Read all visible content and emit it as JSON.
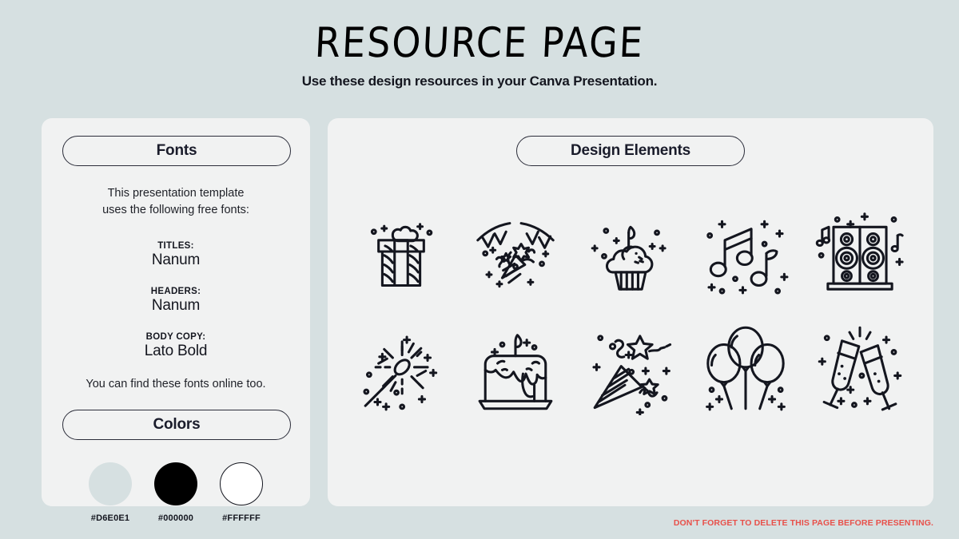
{
  "header": {
    "title": "RESOURCE PAGE",
    "subtitle": "Use these design resources in your Canva Presentation."
  },
  "fonts_panel": {
    "heading": "Fonts",
    "intro": "This presentation template\nuses the following free fonts:",
    "entries": [
      {
        "label": "TITLES:",
        "value": "Nanum"
      },
      {
        "label": "HEADERS:",
        "value": "Nanum"
      },
      {
        "label": "BODY COPY:",
        "value": "Lato Bold"
      }
    ],
    "footer": "You can find these fonts online too."
  },
  "colors_panel": {
    "heading": "Colors",
    "swatches": [
      {
        "hex": "#D6E0E1",
        "label": "#D6E0E1",
        "outlined": false
      },
      {
        "hex": "#000000",
        "label": "#000000",
        "outlined": false
      },
      {
        "hex": "#FFFFFF",
        "label": "#FFFFFF",
        "outlined": true
      }
    ]
  },
  "design_panel": {
    "heading": "Design Elements",
    "icons": [
      {
        "name": "gift-box-icon",
        "label": "Gift box with bow"
      },
      {
        "name": "party-bunting-popper-icon",
        "label": "Bunting flags with party popper"
      },
      {
        "name": "cupcake-candle-icon",
        "label": "Cupcake with candle"
      },
      {
        "name": "music-notes-icon",
        "label": "Music notes"
      },
      {
        "name": "speakers-icon",
        "label": "Loudspeakers"
      },
      {
        "name": "sparkler-icon",
        "label": "Sparkler"
      },
      {
        "name": "birthday-cake-icon",
        "label": "Birthday cake with candle"
      },
      {
        "name": "party-popper-icon",
        "label": "Party popper with confetti"
      },
      {
        "name": "balloons-icon",
        "label": "Balloons"
      },
      {
        "name": "champagne-glasses-icon",
        "label": "Champagne glasses toasting"
      }
    ]
  },
  "footer": {
    "warning": "DON'T FORGET TO DELETE THIS PAGE BEFORE PRESENTING."
  }
}
